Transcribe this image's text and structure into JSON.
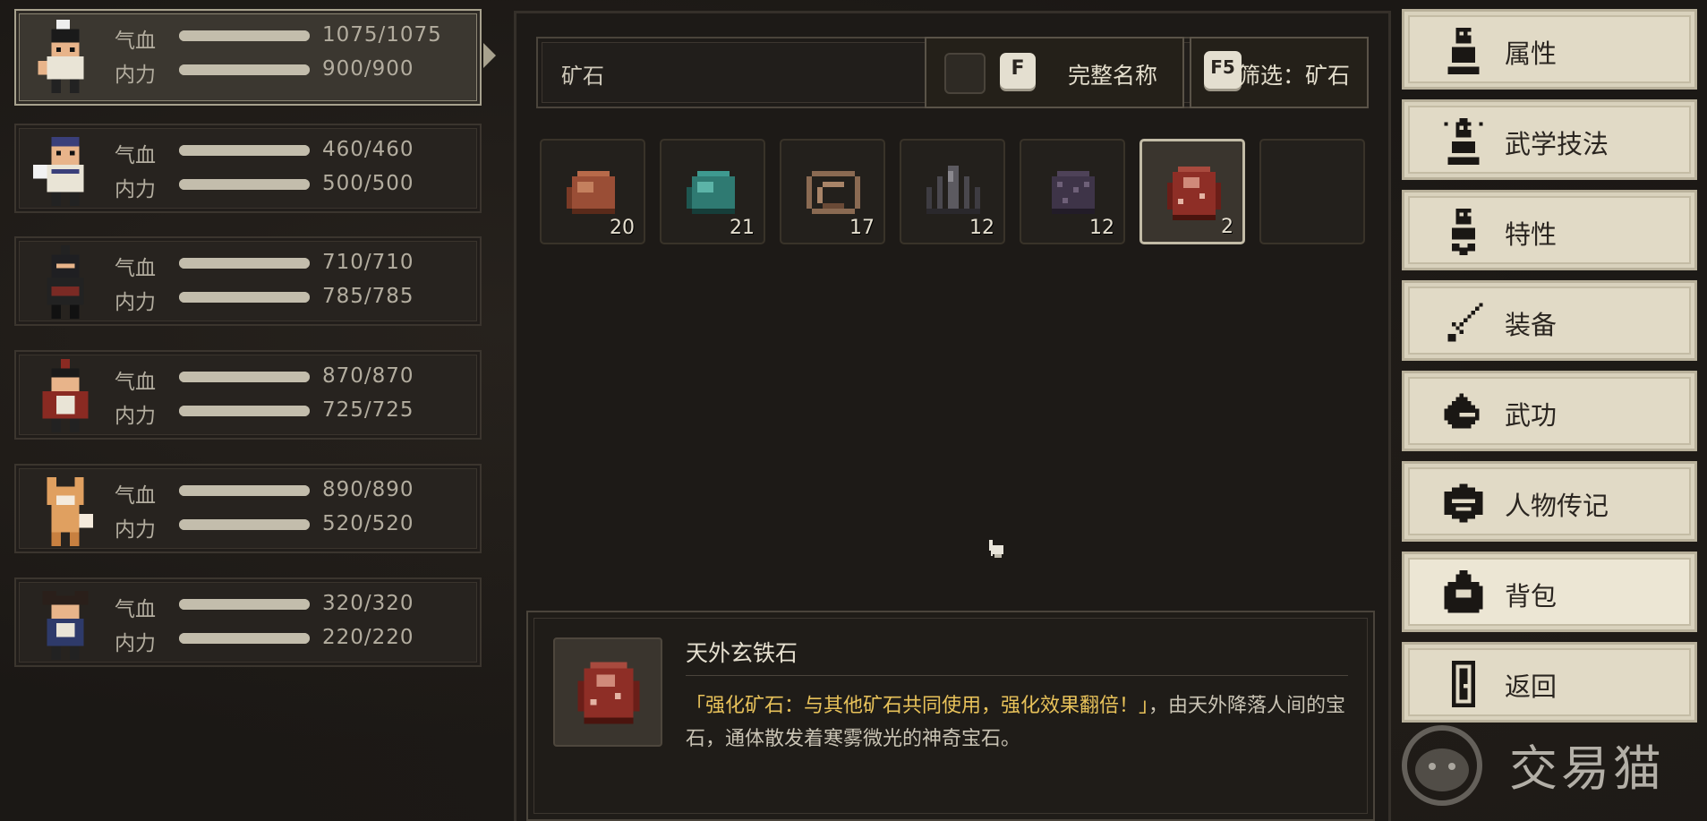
{
  "party": [
    {
      "hp_label": "气血",
      "hp": "1075/1075",
      "mp_label": "内力",
      "mp": "900/900",
      "selected": true
    },
    {
      "hp_label": "气血",
      "hp": "460/460",
      "mp_label": "内力",
      "mp": "500/500",
      "selected": false
    },
    {
      "hp_label": "气血",
      "hp": "710/710",
      "mp_label": "内力",
      "mp": "785/785",
      "selected": false
    },
    {
      "hp_label": "气血",
      "hp": "870/870",
      "mp_label": "内力",
      "mp": "725/725",
      "selected": false
    },
    {
      "hp_label": "气血",
      "hp": "890/890",
      "mp_label": "内力",
      "mp": "520/520",
      "selected": false
    },
    {
      "hp_label": "气血",
      "hp": "320/320",
      "mp_label": "内力",
      "mp": "220/220",
      "selected": false
    }
  ],
  "inventory": {
    "search": {
      "value": "矿石"
    },
    "fullname": {
      "key": "F",
      "label": "完整名称"
    },
    "filter": {
      "key": "F5",
      "label": "筛选：矿石"
    },
    "items": [
      {
        "name": "copper-ore",
        "count": "20",
        "color": "#9a4e36"
      },
      {
        "name": "jade-ore",
        "count": "21",
        "color": "#2f7a72"
      },
      {
        "name": "wire-ore",
        "count": "17",
        "color": "#8a6a52"
      },
      {
        "name": "crystal-ore",
        "count": "12",
        "color": "#5c5a60"
      },
      {
        "name": "dark-iron-ore",
        "count": "12",
        "color": "#3e3448"
      },
      {
        "name": "meteor-iron-ore",
        "count": "2",
        "color": "#8e2e26",
        "selected": true
      },
      {
        "name": "empty-slot",
        "count": "",
        "color": ""
      }
    ]
  },
  "detail": {
    "name": "天外玄铁石",
    "desc_highlight": "「强化矿石：与其他矿石共同使用，强化效果翻倍！」",
    "desc_rest": "，由天外降落人间的宝石，通体散发着寒雾微光的神奇宝石。"
  },
  "menu": [
    {
      "label": "属性",
      "icon": "person-icon"
    },
    {
      "label": "武学技法",
      "icon": "idea-icon"
    },
    {
      "label": "特性",
      "icon": "heart-person-icon"
    },
    {
      "label": "装备",
      "icon": "sword-icon"
    },
    {
      "label": "武功",
      "icon": "book-icon"
    },
    {
      "label": "人物传记",
      "icon": "scroll-icon"
    },
    {
      "label": "背包",
      "icon": "bag-icon",
      "active": true
    },
    {
      "label": "返回",
      "icon": "door-icon"
    }
  ],
  "watermark": {
    "text": "交易猫"
  }
}
